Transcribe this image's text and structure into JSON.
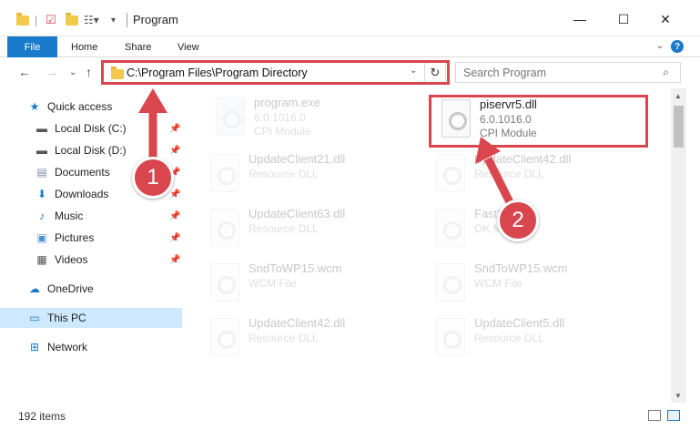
{
  "window": {
    "title": "Program",
    "minimize_icon": "minimize-icon",
    "maximize_icon": "maximize-icon",
    "close_icon": "close-icon"
  },
  "ribbon": {
    "tabs": [
      "File",
      "Home",
      "Share",
      "View"
    ],
    "help_label": "?"
  },
  "address_bar": {
    "path": "C:\\Program Files\\Program Directory",
    "search_placeholder": "Search Program"
  },
  "sidebar": {
    "items": [
      {
        "label": "Quick access",
        "icon": "star-icon",
        "pinned": false
      },
      {
        "label": "Local Disk (C:)",
        "icon": "drive-icon",
        "pinned": true
      },
      {
        "label": "Local Disk (D:)",
        "icon": "drive-icon",
        "pinned": true
      },
      {
        "label": "Documents",
        "icon": "documents-icon",
        "pinned": true
      },
      {
        "label": "Downloads",
        "icon": "downloads-icon",
        "pinned": true
      },
      {
        "label": "Music",
        "icon": "music-icon",
        "pinned": true
      },
      {
        "label": "Pictures",
        "icon": "pictures-icon",
        "pinned": true
      },
      {
        "label": "Videos",
        "icon": "videos-icon",
        "pinned": true
      },
      {
        "label": "OneDrive",
        "icon": "onedrive-icon",
        "pinned": false
      },
      {
        "label": "This PC",
        "icon": "pc-icon",
        "pinned": false,
        "selected": true
      },
      {
        "label": "Network",
        "icon": "network-icon",
        "pinned": false
      }
    ]
  },
  "files": [
    {
      "name": "program.exe",
      "line2": "6.0.1016.0",
      "line3": "CPI Module",
      "faded": true
    },
    {
      "name": "piservr5.dll",
      "line2": "6.0.1016.0",
      "line3": "CPI Module",
      "faded": false
    },
    {
      "name": "UpdateClient21.dll",
      "line2": "Resource DLL",
      "line3": "",
      "faded": true
    },
    {
      "name": "UpdateClient42.dll",
      "line2": "Resource DLL",
      "line3": "",
      "faded": true
    },
    {
      "name": "UpdateClient63.dll",
      "line2": "Resource DLL",
      "line3": "",
      "faded": true
    },
    {
      "name": "FastBoot.dll",
      "line2": "OK Module",
      "line3": "",
      "faded": true
    },
    {
      "name": "SndToWP15.wcm",
      "line2": "WCM File",
      "line3": "",
      "faded": true
    },
    {
      "name": "SndToWP15.wcm",
      "line2": "WCM File",
      "line3": "",
      "faded": true
    },
    {
      "name": "UpdateClient42.dll",
      "line2": "Resource DLL",
      "line3": "",
      "faded": true
    },
    {
      "name": "UpdateClient5.dll",
      "line2": "Resource DLL",
      "line3": "",
      "faded": true
    }
  ],
  "status": {
    "item_count": "192 items"
  },
  "annotations": {
    "step1": "1",
    "step2": "2",
    "color": "#d9464e"
  },
  "colors": {
    "accent": "#1979ca",
    "selection": "#cde8ff",
    "highlight": "#d9464e"
  }
}
